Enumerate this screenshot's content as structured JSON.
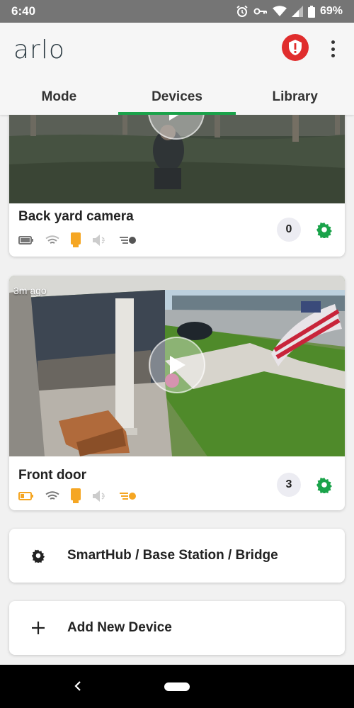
{
  "status_bar": {
    "time": "6:40",
    "battery": "69%"
  },
  "app": {
    "logo": "arlo"
  },
  "tabs": [
    {
      "label": "Mode",
      "active": false
    },
    {
      "label": "Devices",
      "active": true
    },
    {
      "label": "Library",
      "active": false
    }
  ],
  "devices": [
    {
      "name": "Back yard camera",
      "timestamp": "",
      "event_count": "0",
      "status_icons": [
        "battery-icon",
        "wifi-icon",
        "sd-storage-icon",
        "speaker-muted-icon",
        "motion-sensitivity-icon"
      ]
    },
    {
      "name": "Front door",
      "timestamp": "3m ago",
      "event_count": "3",
      "status_icons": [
        "battery-low-icon",
        "wifi-icon",
        "sd-storage-icon",
        "speaker-muted-icon",
        "motion-sensitivity-icon"
      ]
    }
  ],
  "actions": {
    "hub_label": "SmartHub / Base Station / Bridge",
    "add_label": "Add New Device"
  },
  "colors": {
    "accent_green": "#1aa34a",
    "alert_red": "#e02d2d",
    "status_orange": "#f5a623",
    "status_gray": "#9e9e9e"
  }
}
